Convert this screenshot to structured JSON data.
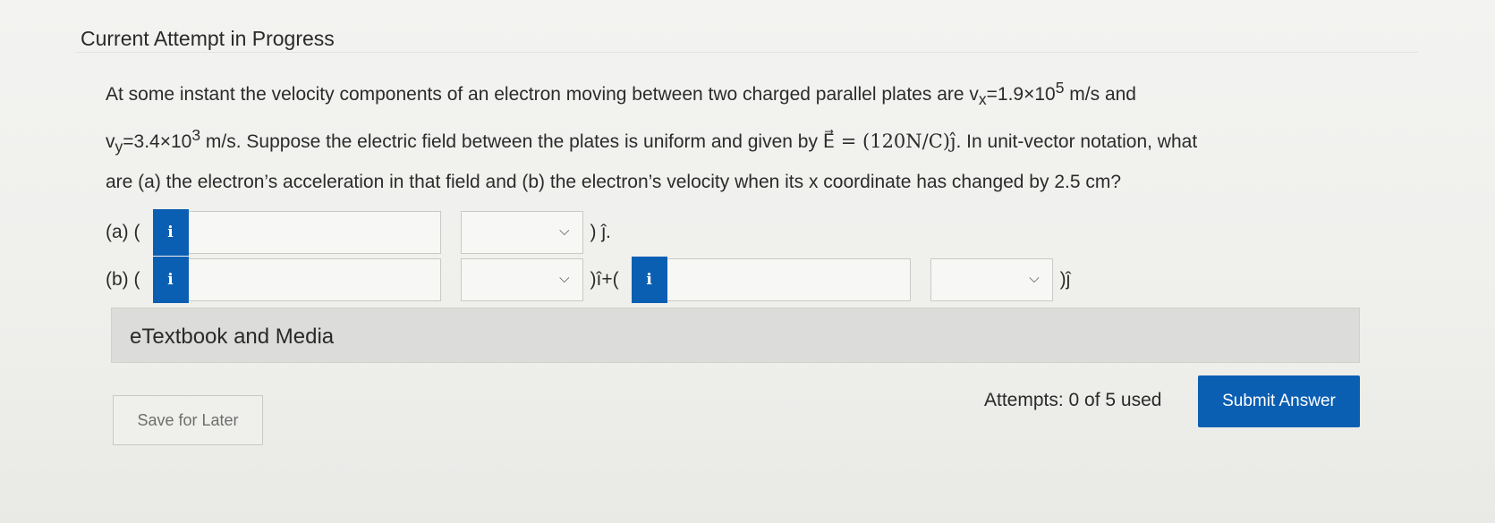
{
  "heading": "Current Attempt in Progress",
  "question": {
    "l1_pre": "At some instant the velocity components of an electron moving between two charged parallel plates are v",
    "l1_sub": "x",
    "l1_mid": "=1.9×10",
    "l1_sup": "5",
    "l1_post": " m/s and",
    "l2_pre": "v",
    "l2_sub": "y",
    "l2_mid": "=3.4×10",
    "l2_sup": "3",
    "l2_post": " m/s. Suppose the electric field between the plates is uniform and given by ",
    "l2_math": "E⃗ = (120N/C)ĵ",
    "l2_end": ". In unit-vector notation, what",
    "l3": "are (a) the electron’s acceleration in that field and (b) the electron’s velocity when its x coordinate has changed by 2.5 cm?"
  },
  "part_a": {
    "label": "(a) (",
    "info": "i",
    "value": "",
    "unit": "",
    "suffix": ") ĵ."
  },
  "part_b": {
    "label": "(b) (",
    "info1": "i",
    "value1": "",
    "unit1": "",
    "mid": ")î+(",
    "info2": "i",
    "value2": "",
    "unit2": "",
    "suffix": ")ĵ"
  },
  "media": {
    "title": "eTextbook and Media"
  },
  "footer": {
    "save_label": "Save for Later",
    "attempts": "Attempts: 0 of 5 used",
    "submit_label": "Submit Answer"
  },
  "icons": {
    "chevron": "chevron-down-icon",
    "info": "info-icon"
  },
  "colors": {
    "accent": "#0b5fb3"
  }
}
